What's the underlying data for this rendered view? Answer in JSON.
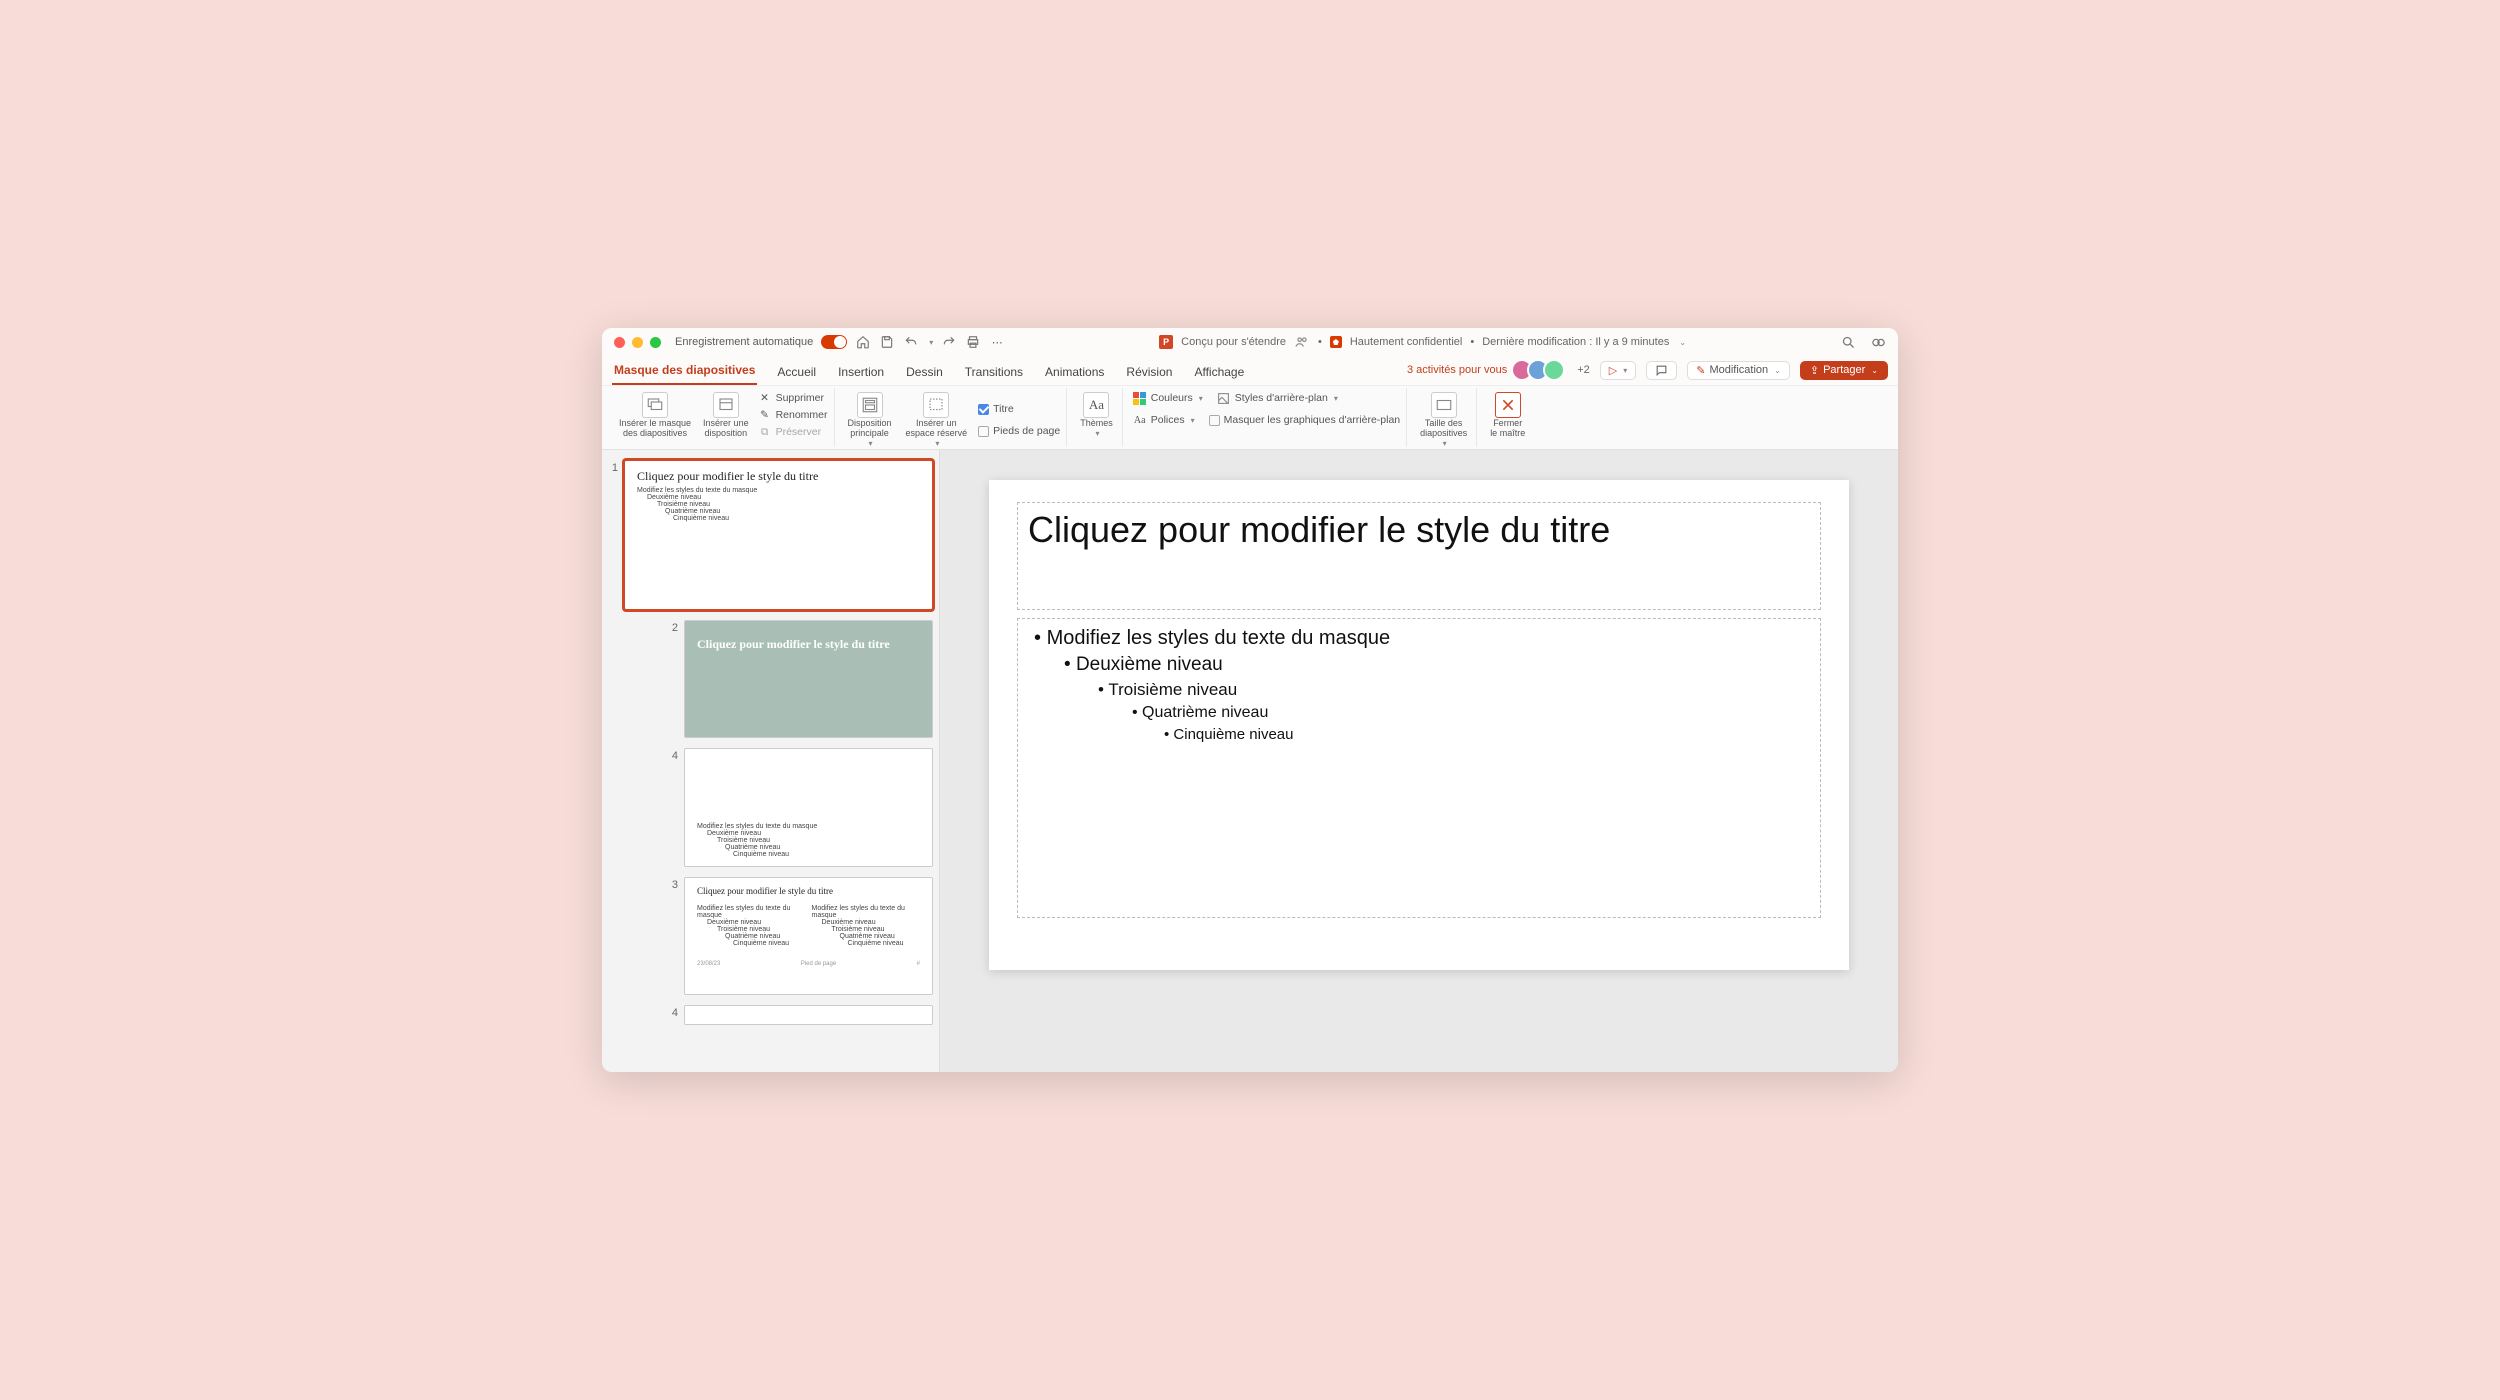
{
  "titlebar": {
    "autosave_label": "Enregistrement automatique",
    "designed_for": "Conçu pour s'étendre",
    "sensitivity": "Hautement confidentiel",
    "last_modified": "Dernière modification : Il y a 9 minutes"
  },
  "tabs": {
    "items": [
      "Masque des diapositives",
      "Accueil",
      "Insertion",
      "Dessin",
      "Transitions",
      "Animations",
      "Révision",
      "Affichage"
    ],
    "activities": "3 activités pour vous",
    "plus_count": "+2",
    "modification": "Modification",
    "share": "Partager"
  },
  "ribbon": {
    "insert_master": "Insérer le masque\ndes diapositives",
    "insert_layout": "Insérer une\ndisposition",
    "delete": "Supprimer",
    "rename": "Renommer",
    "preserve": "Préserver",
    "master_layout": "Disposition\nprincipale",
    "insert_placeholder": "Insérer un\nespace réservé",
    "cb_title": "Titre",
    "cb_footers": "Pieds de page",
    "themes": "Thèmes",
    "colors": "Couleurs",
    "fonts": "Polices",
    "bg_styles": "Styles d'arrière-plan",
    "hide_bg": "Masquer les graphiques d'arrière-plan",
    "slide_size": "Taille des\ndiapositives",
    "close_master": "Fermer\nle maître"
  },
  "thumbs": [
    {
      "num": "1",
      "variant": "master",
      "title": "Cliquez pour modifier le style du titre"
    },
    {
      "num": "2",
      "variant": "title-green",
      "title": "Cliquez pour modifier le style du titre"
    },
    {
      "num": "4",
      "variant": "content-bottom",
      "title": ""
    },
    {
      "num": "3",
      "variant": "two-content",
      "title": "Cliquez pour modifier le style du titre"
    },
    {
      "num": "4",
      "variant": "blank",
      "title": ""
    }
  ],
  "bullets": {
    "l1": "Modifiez les styles du texte du masque",
    "l2": "Deuxième niveau",
    "l3": "Troisième niveau",
    "l4": "Quatrième niveau",
    "l5": "Cinquième niveau"
  },
  "slide": {
    "title": "Cliquez pour modifier le style du titre"
  },
  "thumb_footer": {
    "date": "23/08/23",
    "footer": "Pied de page"
  }
}
